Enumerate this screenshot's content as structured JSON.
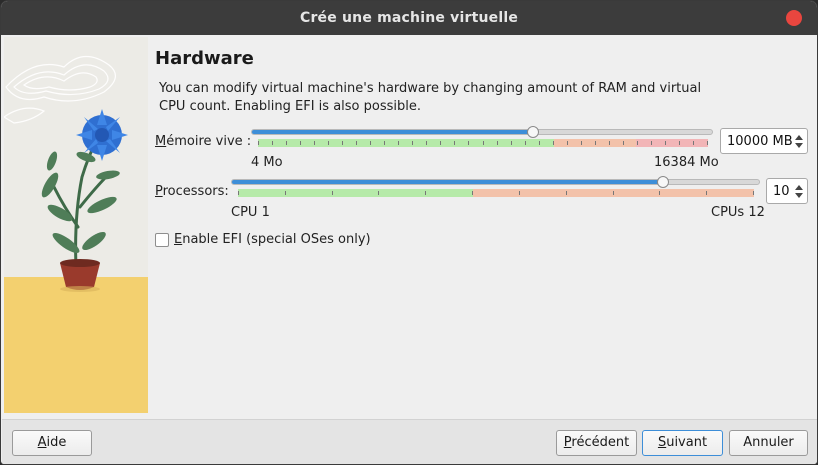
{
  "window": {
    "title": "Crée une machine virtuelle"
  },
  "page": {
    "heading": "Hardware",
    "description": "You can modify virtual machine's hardware by changing amount of RAM and virtual CPU count. Enabling EFI is also possible."
  },
  "memory": {
    "label_mnemonic": "M",
    "label_rest": "émoire vive :",
    "value": "10000 MB",
    "min_label": "4 Mo",
    "max_label": "16384 Mo",
    "level_fraction": 0.61
  },
  "processors": {
    "label_mnemonic": "P",
    "label_rest": "rocessors:",
    "value": "10",
    "min_label": "CPU 1",
    "max_label": "CPUs 12",
    "level_fraction": 0.818
  },
  "efi": {
    "label_mnemonic": "E",
    "label_rest": "nable EFI (special OSes only)",
    "checked": false
  },
  "footer": {
    "help_mnemonic": "A",
    "help_rest": "ide",
    "back_mnemonic": "P",
    "back_rest": "récédent",
    "next_mnemonic": "S",
    "next_rest": "uivant",
    "cancel_label": "Annuler"
  },
  "colors": {
    "accent": "#3d8ed8",
    "titlebar": "#3c3c3c",
    "close": "#e9463f",
    "zone_ok": "#b6eaa9",
    "zone_warn": "#f3c2aa",
    "zone_danger": "#f2b5b7"
  }
}
